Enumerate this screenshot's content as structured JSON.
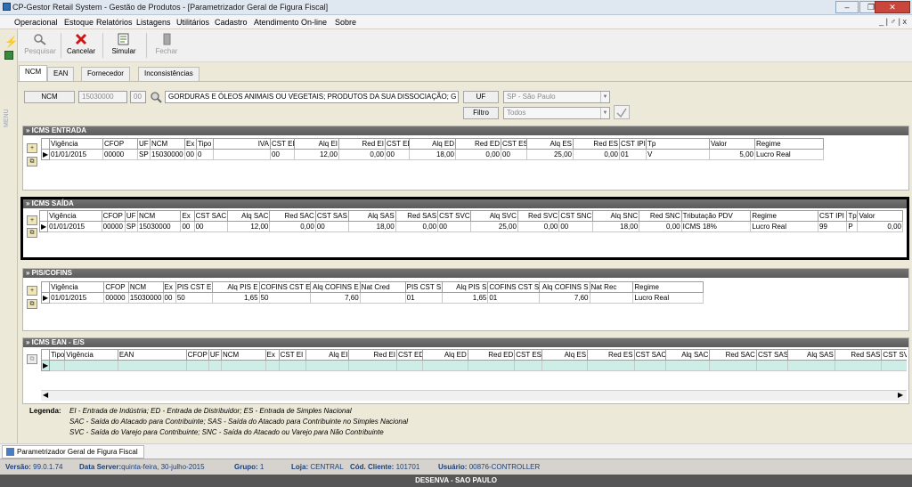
{
  "window": {
    "title": "CP-Gestor Retail System - Gestão de Produtos - [Parametrizador Geral de Figura Fiscal]",
    "mdi_controls": "_ | ♂ | x"
  },
  "menu": [
    "Operacional",
    "Estoque",
    "Relatórios",
    "Listagens",
    "Utilitários",
    "Cadastro",
    "Atendimento On-line",
    "Sobre"
  ],
  "toolbar": {
    "pesquisar": "Pesquisar",
    "cancelar": "Cancelar",
    "simular": "Simular",
    "fechar": "Fechar"
  },
  "tabs": [
    "NCM",
    "EAN",
    "Fornecedor",
    "Inconsistências"
  ],
  "side_label": "MENU",
  "ncm": {
    "label": "NCM",
    "code": "15030000",
    "suffix": "00",
    "description": "GORDURAS E ÓLEOS ANIMAIS OU VEGETAIS; PRODUTOS DA SUA DISSOCIAÇÃO; G"
  },
  "uf": {
    "label": "UF",
    "value": "SP - São Paulo"
  },
  "filtro": {
    "label": "Filtro",
    "value": "Todos"
  },
  "icms_entrada": {
    "title": "» ICMS ENTRADA",
    "headers": [
      "Vigência",
      "CFOP",
      "UF",
      "NCM",
      "Ex",
      "Tipo",
      "IVA",
      "CST EI",
      "Alq EI",
      "Red EI",
      "CST ED",
      "Alq ED",
      "Red ED",
      "CST ES",
      "Alq ES",
      "Red ES",
      "CST IPI",
      "Tp",
      "Valor",
      "Regime"
    ],
    "row": [
      "01/01/2015",
      "00000",
      "SP",
      "15030000",
      "00",
      "0",
      "",
      "00",
      "12,00",
      "0,00",
      "00",
      "18,00",
      "0,00",
      "00",
      "25,00",
      "0,00",
      "01",
      "V",
      "5,00",
      "Lucro Real"
    ]
  },
  "icms_saida": {
    "title": "» ICMS SAÍDA",
    "headers": [
      "Vigência",
      "CFOP",
      "UF",
      "NCM",
      "Ex",
      "CST SAC",
      "Alq SAC",
      "Red SAC",
      "CST SAS",
      "Alq SAS",
      "Red SAS",
      "CST SVC",
      "Alq SVC",
      "Red SVC",
      "CST SNC",
      "Alq SNC",
      "Red SNC",
      "Tributação PDV",
      "Regime",
      "CST IPI",
      "Tp",
      "Valor"
    ],
    "row": [
      "01/01/2015",
      "00000",
      "SP",
      "15030000",
      "00",
      "00",
      "12,00",
      "0,00",
      "00",
      "18,00",
      "0,00",
      "00",
      "25,00",
      "0,00",
      "00",
      "18,00",
      "0,00",
      "ICMS 18%",
      "Lucro Real",
      "99",
      "P",
      "0,00"
    ]
  },
  "pis_cofins": {
    "title": "» PIS/COFINS",
    "headers": [
      "Vigência",
      "CFOP",
      "NCM",
      "Ex",
      "PIS CST E",
      "Alq PIS E",
      "COFINS CST E",
      "Alq COFINS E",
      "Nat Cred",
      "PIS CST S",
      "Alq PIS S",
      "COFINS CST S",
      "Alq COFINS S",
      "Nat Rec",
      "Regime"
    ],
    "row": [
      "01/01/2015",
      "00000",
      "15030000",
      "00",
      "50",
      "1,65",
      "50",
      "7,60",
      "",
      "01",
      "1,65",
      "01",
      "7,60",
      "",
      "Lucro Real"
    ]
  },
  "icms_ean": {
    "title": "» ICMS EAN - E/S",
    "headers": [
      "Tipo",
      "Vigência",
      "EAN",
      "CFOP",
      "UF",
      "NCM",
      "Ex",
      "CST EI",
      "Alq EI",
      "Red EI",
      "CST ED",
      "Alq ED",
      "Red ED",
      "CST ES",
      "Alq ES",
      "Red ES",
      "CST SAC",
      "Alq SAC",
      "Red SAC",
      "CST SAS",
      "Alq SAS",
      "Red SAS",
      "CST SVC",
      "A"
    ]
  },
  "legend": {
    "title": "Legenda:",
    "lines": [
      "EI - Entrada de Indústria;  ED - Entrada de Distribuidor;  ES - Entrada de Simples Nacional",
      "SAC - Saída do Atacado para Contribuinte;  SAS - Saída do Atacado para Contribuinte no Simples Nacional",
      "SVC - Saída do Varejo para Contribuinte;  SNC - Saída do Atacado ou Varejo para Não Contribuinte"
    ]
  },
  "taskbar": {
    "item": "Parametrizador Geral de Figura Fiscal"
  },
  "status": {
    "versao_l": "Versão:",
    "versao": "99.0.1.74",
    "server_l": "Data Server:",
    "server": "quinta-feira, 30-julho-2015",
    "grupo_l": "Grupo:",
    "grupo": "1",
    "loja_l": "Loja:",
    "loja": "CENTRAL",
    "cliente_l": "Cód. Cliente:",
    "cliente": "101701",
    "usuario_l": "Usuário:",
    "usuario": "00876-CONTROLLER",
    "footer": "DESENVA - SAO PAULO"
  }
}
